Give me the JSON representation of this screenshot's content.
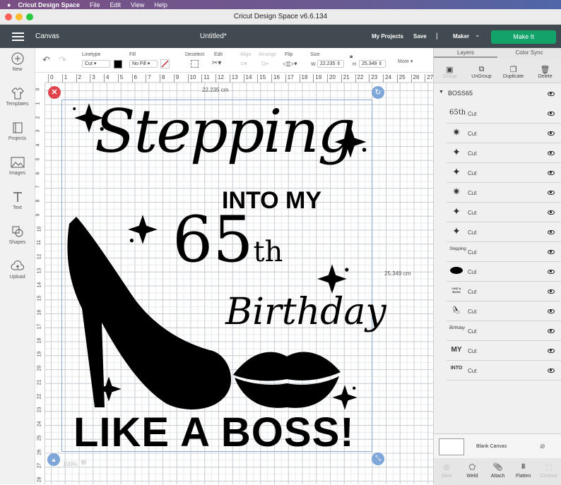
{
  "menubar": {
    "app": "Cricut Design Space",
    "items": [
      "File",
      "Edit",
      "View",
      "Help"
    ]
  },
  "window": {
    "title": "Cricut Design Space  v6.6.134"
  },
  "header": {
    "canvas": "Canvas",
    "doc_title": "Untitled*",
    "my_projects": "My Projects",
    "save": "Save",
    "separator": "|",
    "machine": "Maker",
    "make_it": "Make It",
    "make_it_color": "#12a36a"
  },
  "sidebar": [
    {
      "label": "New",
      "icon": "plus-circle-icon"
    },
    {
      "label": "Templates",
      "icon": "shirt-icon"
    },
    {
      "label": "Projects",
      "icon": "book-icon"
    },
    {
      "label": "Images",
      "icon": "image-icon"
    },
    {
      "label": "Text",
      "icon": "text-icon"
    },
    {
      "label": "Shapes",
      "icon": "shapes-icon"
    },
    {
      "label": "Upload",
      "icon": "cloud-upload-icon"
    }
  ],
  "toolbar": {
    "linetype_label": "Linetype",
    "linetype_value": "Cut",
    "fill_label": "Fill",
    "fill_value": "No Fill",
    "deselect": "Deselect",
    "edit": "Edit",
    "align": "Align",
    "arrange": "Arrange",
    "flip": "Flip",
    "size": "Size",
    "w_label": "W",
    "w_value": "22.235",
    "h_label": "H",
    "h_value": "25.349",
    "more": "More ▾"
  },
  "rulers": {
    "top": [
      "0",
      "1",
      "2",
      "3",
      "4",
      "5",
      "6",
      "7",
      "8",
      "9",
      "10",
      "11",
      "12",
      "13",
      "14",
      "15",
      "16",
      "17",
      "18",
      "19",
      "20",
      "21",
      "22",
      "23",
      "24",
      "25",
      "26",
      "27"
    ],
    "left": [
      "0",
      "1",
      "2",
      "3",
      "4",
      "5",
      "6",
      "7",
      "8",
      "9",
      "10",
      "11",
      "12",
      "13",
      "14",
      "15",
      "16",
      "17",
      "18",
      "19",
      "20",
      "21",
      "22",
      "23",
      "24",
      "25",
      "26",
      "27",
      "28"
    ]
  },
  "canvas": {
    "width_dim": "22.235 cm",
    "height_dim": "25.349 cm",
    "zoom": "100%",
    "design": {
      "line1": "Stepping",
      "line2": "INTO MY",
      "line3_num": "65",
      "line3_sup": "th",
      "line4": "Birthday",
      "line5": "LIKE A BOSS!"
    }
  },
  "layers_panel": {
    "tabs": [
      "Layers",
      "Color Sync"
    ],
    "actions": [
      "Group",
      "UnGroup",
      "Duplicate",
      "Delete"
    ],
    "group_name": "BOSS65",
    "layers": [
      {
        "thumb": "65th",
        "label": "Cut"
      },
      {
        "thumb": "✷",
        "label": "Cut"
      },
      {
        "thumb": "✦",
        "label": "Cut"
      },
      {
        "thumb": "✦",
        "label": "Cut"
      },
      {
        "thumb": "✷",
        "label": "Cut"
      },
      {
        "thumb": "✦",
        "label": "Cut"
      },
      {
        "thumb": "✦",
        "label": "Cut"
      },
      {
        "thumb": "Stepping",
        "label": "Cut"
      },
      {
        "thumb": "lips",
        "label": "Cut"
      },
      {
        "thumb": "LIKE A BOSS",
        "label": "Cut"
      },
      {
        "thumb": "shoe",
        "label": "Cut"
      },
      {
        "thumb": "Birthday",
        "label": "Cut"
      },
      {
        "thumb": "MY",
        "label": "Cut"
      },
      {
        "thumb": "INTO",
        "label": "Cut"
      }
    ],
    "blank_canvas": "Blank Canvas",
    "bottom_actions": [
      "Slice",
      "Weld",
      "Attach",
      "Flatten",
      "Contour"
    ]
  }
}
